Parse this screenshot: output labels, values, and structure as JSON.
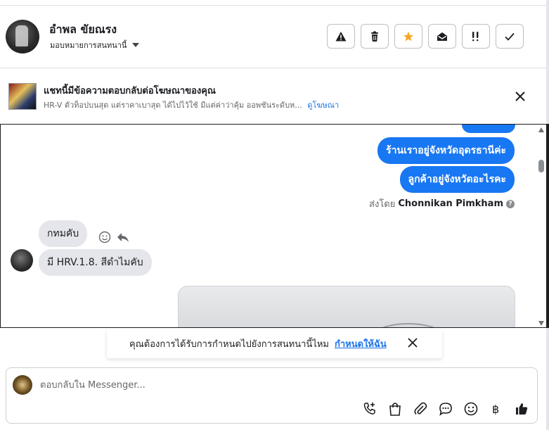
{
  "header": {
    "contact_name": "อำพล ขัยณรง",
    "assign_label": "มอบหมายการสนทนานี้",
    "actions": [
      "spam-icon",
      "trash-icon",
      "star-icon",
      "mark-unread-icon",
      "follow-up-icon",
      "done-icon"
    ]
  },
  "ad_banner": {
    "title": "แชทนี้มีข้อความตอบกลับต่อโฆษณาของคุณ",
    "subtitle": "HR-V ตัวท็อปบนสุด แต่ราคาเบาสุด ได้ไปไว้ใช้ มีแต่ค่าว่าคุ้ม ออพชันระดับห...",
    "link": "ดูโฆษณา"
  },
  "messages": {
    "out_1": "ร้านเราอยู่จังหวัดอุดรธานีค่ะ",
    "out_2": "ลูกค้าอยู่จังหวัดอะไรคะ",
    "sent_by_prefix": "ส่งโดย",
    "sent_by_name": "Chonnikan Pimkham",
    "in_1": "กทมคับ",
    "in_2": "มี  HRV.1.8.   สีดำไมคับ"
  },
  "reminder": {
    "text": "คุณต้องการได้รับการกำหนดไปยังการสนทนานี้ไหม",
    "link": "กำหนดให้ฉัน"
  },
  "composer": {
    "placeholder": "ตอบกลับใน Messenger...",
    "tools": [
      "call-icon",
      "shop-icon",
      "attach-icon",
      "saved-reply-icon",
      "emoji-icon",
      "payment-icon",
      "like-icon"
    ]
  },
  "colors": {
    "accent": "#1877f2",
    "bubble_in": "#e4e6eb",
    "link": "#1a73e8",
    "star": "#f5a623"
  }
}
